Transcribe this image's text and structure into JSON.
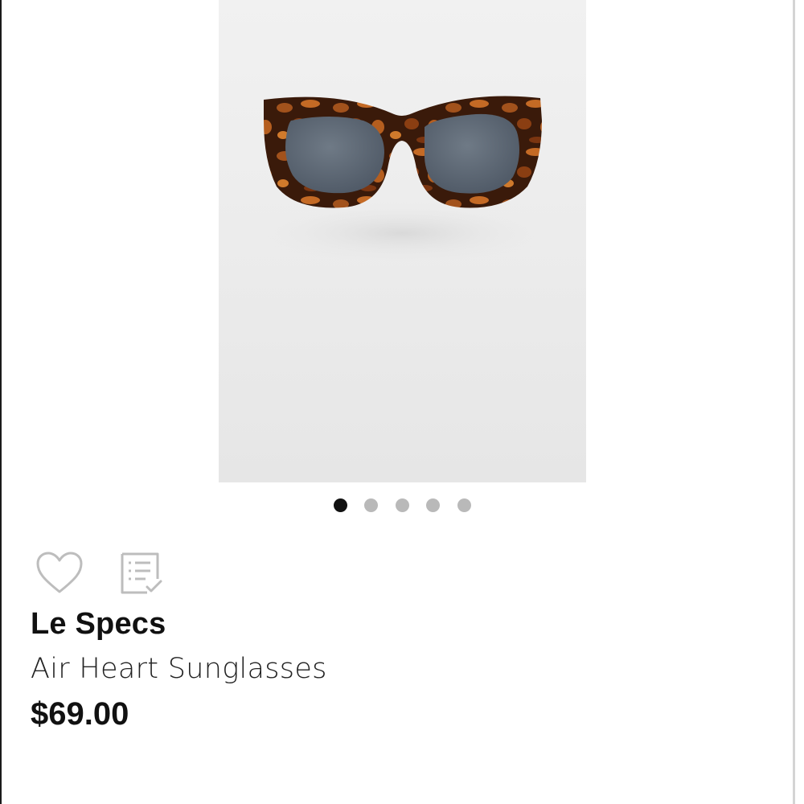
{
  "product": {
    "image_alt": "Air Heart Sunglasses",
    "brand": "Le Specs",
    "name": "Air Heart Sunglasses",
    "price": "$69.00"
  },
  "gallery": {
    "total_images": 5,
    "active_index": 0
  },
  "actions": {
    "favorite_icon": "heart-outline-icon",
    "add_to_list_icon": "checklist-icon"
  },
  "colors": {
    "dot_active": "#111111",
    "dot_inactive": "#b9b9b9",
    "icon_stroke": "#bdbdbd"
  }
}
